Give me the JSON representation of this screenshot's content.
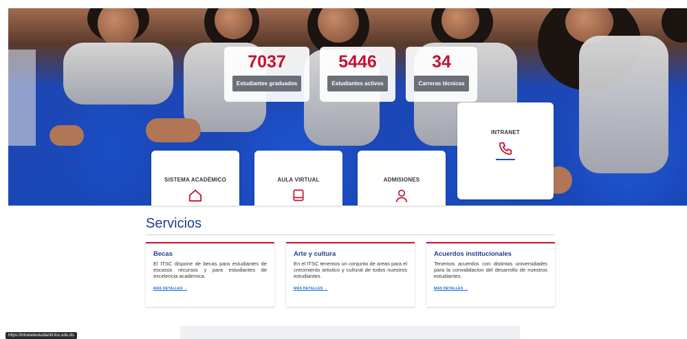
{
  "stats": [
    {
      "value": "7037",
      "label": "Estudiantes graduados"
    },
    {
      "value": "5446",
      "label": "Estudiantes activos"
    },
    {
      "value": "34",
      "label": "Carreras técnicas"
    }
  ],
  "access": {
    "intranet": {
      "label": "INTRANET",
      "icon": "phone-icon"
    },
    "academico": {
      "label": "SISTEMA ACADÉMICO",
      "icon": "home-icon"
    },
    "aula": {
      "label": "AULA VIRTUAL",
      "icon": "book-icon"
    },
    "admisiones": {
      "label": "ADMISIONES",
      "icon": "user-icon"
    }
  },
  "services": {
    "title": "Servicios",
    "items": [
      {
        "title": "Becas",
        "description": "El ITSC dispone de becas para estudiantes de escasos recursos y para estudiantes de excelencia academica.",
        "link": "MÁS DETALLES →"
      },
      {
        "title": "Arte y cultura",
        "description": "En el ITSC tenemos un conjunto de areas para el crecimiento artistico y cultural de todos nuestros estudiantes.",
        "link": "MÁS DETALLES →"
      },
      {
        "title": "Acuerdos institucionales",
        "description": "Tenemos acuerdos con distintas universidades para la convalidacion del desarrollo de nuestros estudiantes.",
        "link": "MÁS DETALLES →"
      }
    ]
  },
  "status_bar": {
    "url": "https://intranetestudiantil.itsc.edu.do"
  },
  "colors": {
    "accent": "#c8102e",
    "brand_blue": "#1f3f8f",
    "link": "#1a6ed8"
  }
}
